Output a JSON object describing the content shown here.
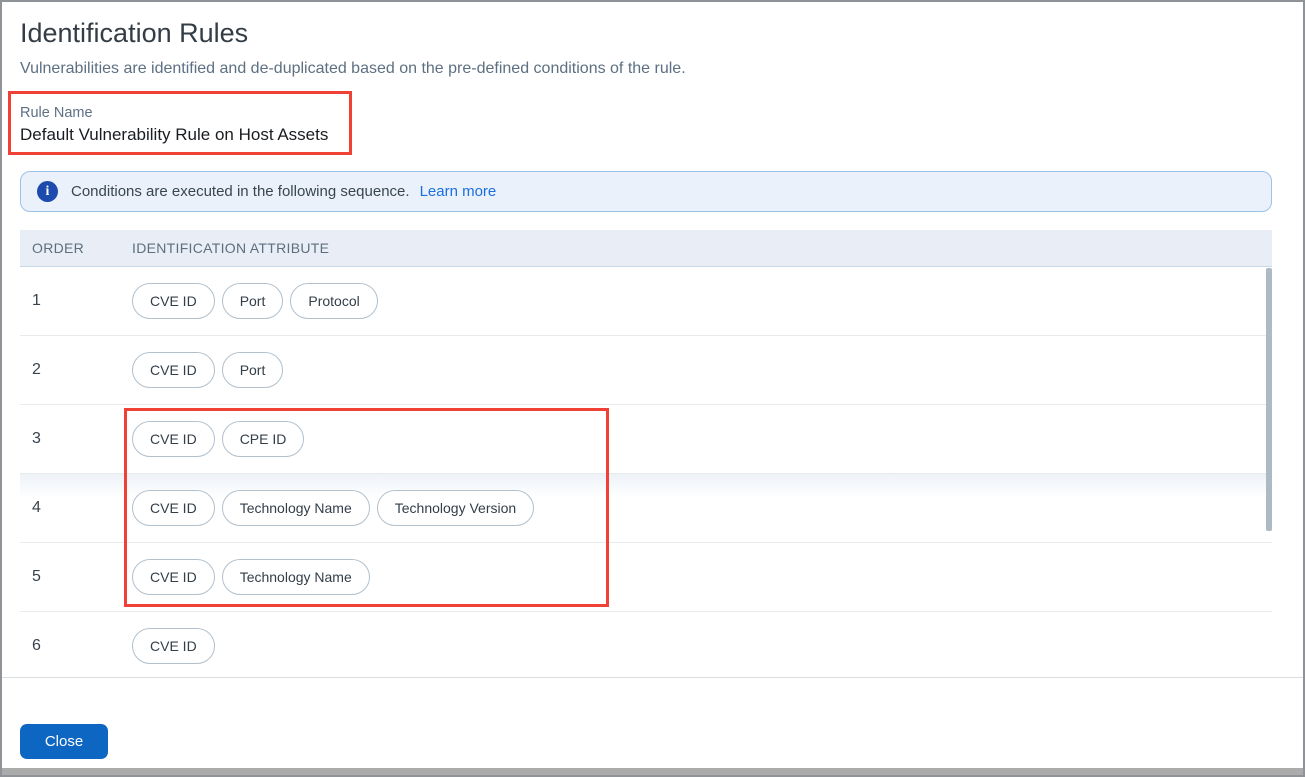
{
  "page": {
    "title": "Identification Rules",
    "subtitle": "Vulnerabilities are identified and de-duplicated based on the pre-defined conditions of the rule."
  },
  "rule_name": {
    "label": "Rule Name",
    "value": "Default Vulnerability Rule on Host Assets"
  },
  "banner": {
    "icon": "info-icon",
    "icon_glyph": "i",
    "text": "Conditions are executed in the following sequence.",
    "link_label": "Learn more"
  },
  "table": {
    "columns": [
      "ORDER",
      "IDENTIFICATION ATTRIBUTE"
    ],
    "rows": [
      {
        "order": "1",
        "attributes": [
          "CVE ID",
          "Port",
          "Protocol"
        ]
      },
      {
        "order": "2",
        "attributes": [
          "CVE ID",
          "Port"
        ]
      },
      {
        "order": "3",
        "attributes": [
          "CVE ID",
          "CPE ID"
        ]
      },
      {
        "order": "4",
        "attributes": [
          "CVE ID",
          "Technology Name",
          "Technology Version"
        ]
      },
      {
        "order": "5",
        "attributes": [
          "CVE ID",
          "Technology Name"
        ]
      },
      {
        "order": "6",
        "attributes": [
          "CVE ID"
        ]
      }
    ]
  },
  "footer": {
    "close_label": "Close"
  },
  "colors": {
    "accent_blue": "#0d66c2",
    "icon_blue": "#1d4aad",
    "link_blue": "#1a6fe0",
    "annotation_red": "#ef4136",
    "banner_bg": "#eaf1fb",
    "banner_border": "#9dc1e7",
    "header_bg": "#e9eef6"
  }
}
